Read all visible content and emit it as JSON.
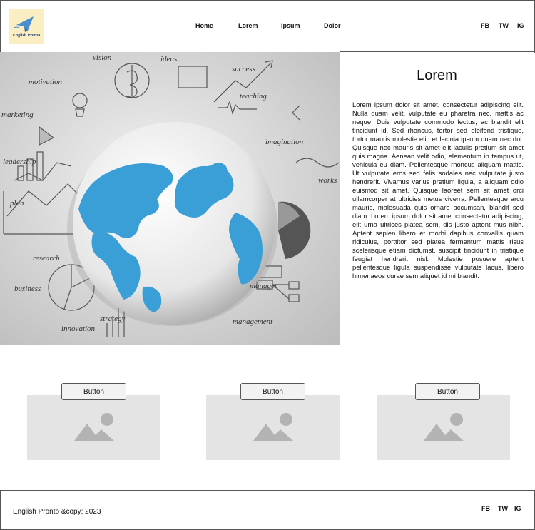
{
  "header": {
    "logo_text": "English Pronto",
    "nav": [
      "Home",
      "Lorem",
      "Ipsum",
      "Dolor"
    ],
    "social": [
      "FB",
      "TW",
      "IG"
    ]
  },
  "hero": {
    "labels": [
      "vision",
      "ideas",
      "success",
      "motivation",
      "teaching",
      "marketing",
      "imagination",
      "leadership",
      "works",
      "plan",
      "research",
      "business",
      "innovation",
      "strategy",
      "manager",
      "management"
    ]
  },
  "panel": {
    "title": "Lorem",
    "body": "Lorem ipsum dolor sit amet, consectetur adipiscing elit. Nulla quam velit, vulputate eu pharetra nec, mattis ac neque. Duis vulputate commodo lectus, ac blandit elit tincidunt id. Sed rhoncus, tortor sed eleifend tristique, tortor mauris molestie elit, et lacinia ipsum quam nec dui. Quisque nec mauris sit amet elit iaculis pretium sit amet quis magna. Aenean velit odio, elementum in tempus ut, vehicula eu diam. Pellentesque rhoncus aliquam mattis. Ut vulputate eros sed felis sodales nec vulputate justo hendrerit. Vivamus varius pretium ligula, a aliquam odio euismod sit amet. Quisque laoreet sem sit amet orci ullamcorper at ultricies metus viverra. Pellentesque arcu mauris, malesuada quis ornare accumsan, blandit sed diam. Lorem ipsum dolor sit amet consectetur adipiscing, elit urna ultrices platea sem, dis justo aptent mus nibh. Aptent sapien libero et morbi dapibus convallis quam ridiculus, porttitor sed platea fermentum mattis risus scelerisque etiam dictumst, suscipit tincidunt in tristique feugiat hendrerit nisl. Molestie posuere aptent pellentesque ligula suspendisse vulputate lacus, libero himenaeos curae sem aliquet id mi blandit."
  },
  "cards": [
    {
      "button_label": "Button"
    },
    {
      "button_label": "Button"
    },
    {
      "button_label": "Button"
    }
  ],
  "footer": {
    "copyright": "English Pronto &copy; 2023",
    "social": [
      "FB",
      "TW",
      "IG"
    ]
  },
  "colors": {
    "globe_ocean": "#f2f2f2",
    "globe_land": "#3a9fd6",
    "placeholder_bg": "#e4e4e4",
    "placeholder_icon": "#b3b3b3",
    "logo_bg": "#fbeec3"
  }
}
